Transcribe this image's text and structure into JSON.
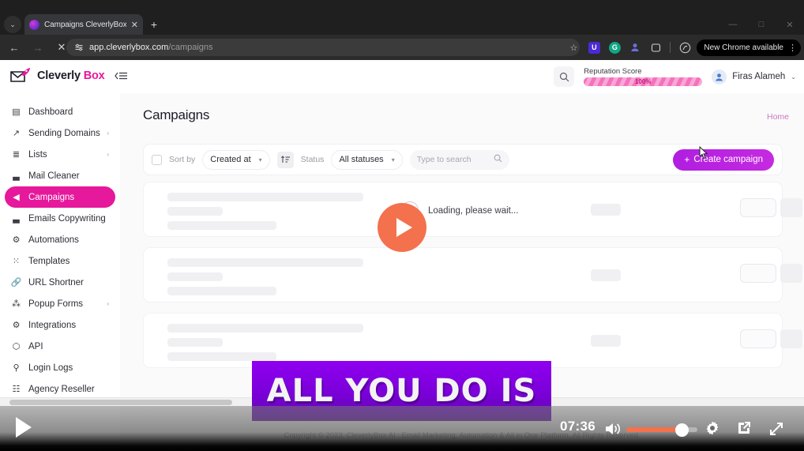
{
  "browser": {
    "tab": {
      "title": "Campaigns  CleverlyBox AI : Em",
      "favicon_name": "cleverlybox-favicon",
      "close_label": "✕"
    },
    "new_tab_label": "+",
    "tabstrip_chevron": "⌄",
    "nav": {
      "back": "←",
      "forward": "→",
      "stop": "✕"
    },
    "omnibox": {
      "site_info_icon": "page-settings-icon",
      "domain": "app.cleverlybox.com",
      "path": "/campaigns"
    },
    "toolbar_icons": [
      "star-icon",
      "extension-u-icon",
      "grammarly-icon",
      "profile-icon",
      "split-view-icon",
      "incognito-extension-icon"
    ],
    "update_pill": "New Chrome available",
    "kebab": "⋮",
    "window": {
      "minimize": "—",
      "maximize": "□",
      "close": "✕"
    }
  },
  "app": {
    "logo": {
      "name": "Cleverly",
      "accent": "Box"
    },
    "hamburger_name": "collapse-sidebar-toggle",
    "header": {
      "search_icon": "search-icon",
      "reputation": {
        "label": "Reputation Score",
        "value": "100%"
      },
      "user": {
        "name": "Firas Alameh",
        "caret": "⌄"
      }
    },
    "sidebar": {
      "items": [
        {
          "label": "Dashboard",
          "icon": "dashboard-icon",
          "glyph": "▤",
          "chevron": false,
          "active": false
        },
        {
          "label": "Sending Domains",
          "icon": "send-domains-icon",
          "glyph": "↗",
          "chevron": true,
          "active": false
        },
        {
          "label": "Lists",
          "icon": "lists-icon",
          "glyph": "≣",
          "chevron": true,
          "active": false
        },
        {
          "label": "Mail Cleaner",
          "icon": "mail-cleaner-icon",
          "glyph": "▃",
          "chevron": false,
          "active": false
        },
        {
          "label": "Campaigns",
          "icon": "campaigns-icon",
          "glyph": "◀",
          "chevron": false,
          "active": true
        },
        {
          "label": "Emails Copywriting",
          "icon": "emails-copywriting-icon",
          "glyph": "▃",
          "chevron": false,
          "active": false
        },
        {
          "label": "Automations",
          "icon": "automations-icon",
          "glyph": "⚙",
          "chevron": false,
          "active": false
        },
        {
          "label": "Templates",
          "icon": "templates-icon",
          "glyph": "⁙",
          "chevron": false,
          "active": false
        },
        {
          "label": "URL Shortner",
          "icon": "url-shortner-icon",
          "glyph": "🔗",
          "chevron": false,
          "active": false
        },
        {
          "label": "Popup Forms",
          "icon": "popup-forms-icon",
          "glyph": "⁂",
          "chevron": true,
          "active": false
        },
        {
          "label": "Integrations",
          "icon": "integrations-icon",
          "glyph": "⚙",
          "chevron": false,
          "active": false
        },
        {
          "label": "API",
          "icon": "api-icon",
          "glyph": "⬡",
          "chevron": false,
          "active": false
        },
        {
          "label": "Login Logs",
          "icon": "login-logs-icon",
          "glyph": "⚲",
          "chevron": false,
          "active": false
        },
        {
          "label": "Agency Reseller",
          "icon": "agency-reseller-icon",
          "glyph": "☷",
          "chevron": false,
          "active": false
        }
      ]
    },
    "main": {
      "title": "Campaigns",
      "breadcrumb": "Home",
      "toolbar": {
        "select_all_name": "select-all-checkbox",
        "sort_by_label": "Sort by",
        "sort_by_value": "Created at",
        "sort_direction_icon": "sort-ascending-icon",
        "status_label": "Status",
        "status_value": "All statuses",
        "search_placeholder": "Type to search",
        "search_icon": "search-icon",
        "create_button": "Create campaign",
        "create_plus": "+"
      },
      "loading_text": "Loading, please wait...",
      "skeleton_row_count": 3,
      "copyright": "Copyright © 2023. CleverlyBox AI : Email Marketing, Automation & All in One Platform. All Rights Reserved."
    }
  },
  "video": {
    "play_overlay_name": "video-play-overlay",
    "caption": "ALL YOU DO IS",
    "controls": {
      "play_label": "play-button",
      "time": "07:36",
      "volume_icon": "volume-high-icon",
      "volume_percent": 80,
      "settings_icon": "gear-icon",
      "pip_icon": "picture-in-picture-icon",
      "fullscreen_icon": "fullscreen-icon"
    }
  },
  "colors": {
    "brand_pink": "#e6189b",
    "create_purple": "#b01ee0",
    "video_orange": "#f4714e",
    "caption_purple": "#8f00f0"
  }
}
